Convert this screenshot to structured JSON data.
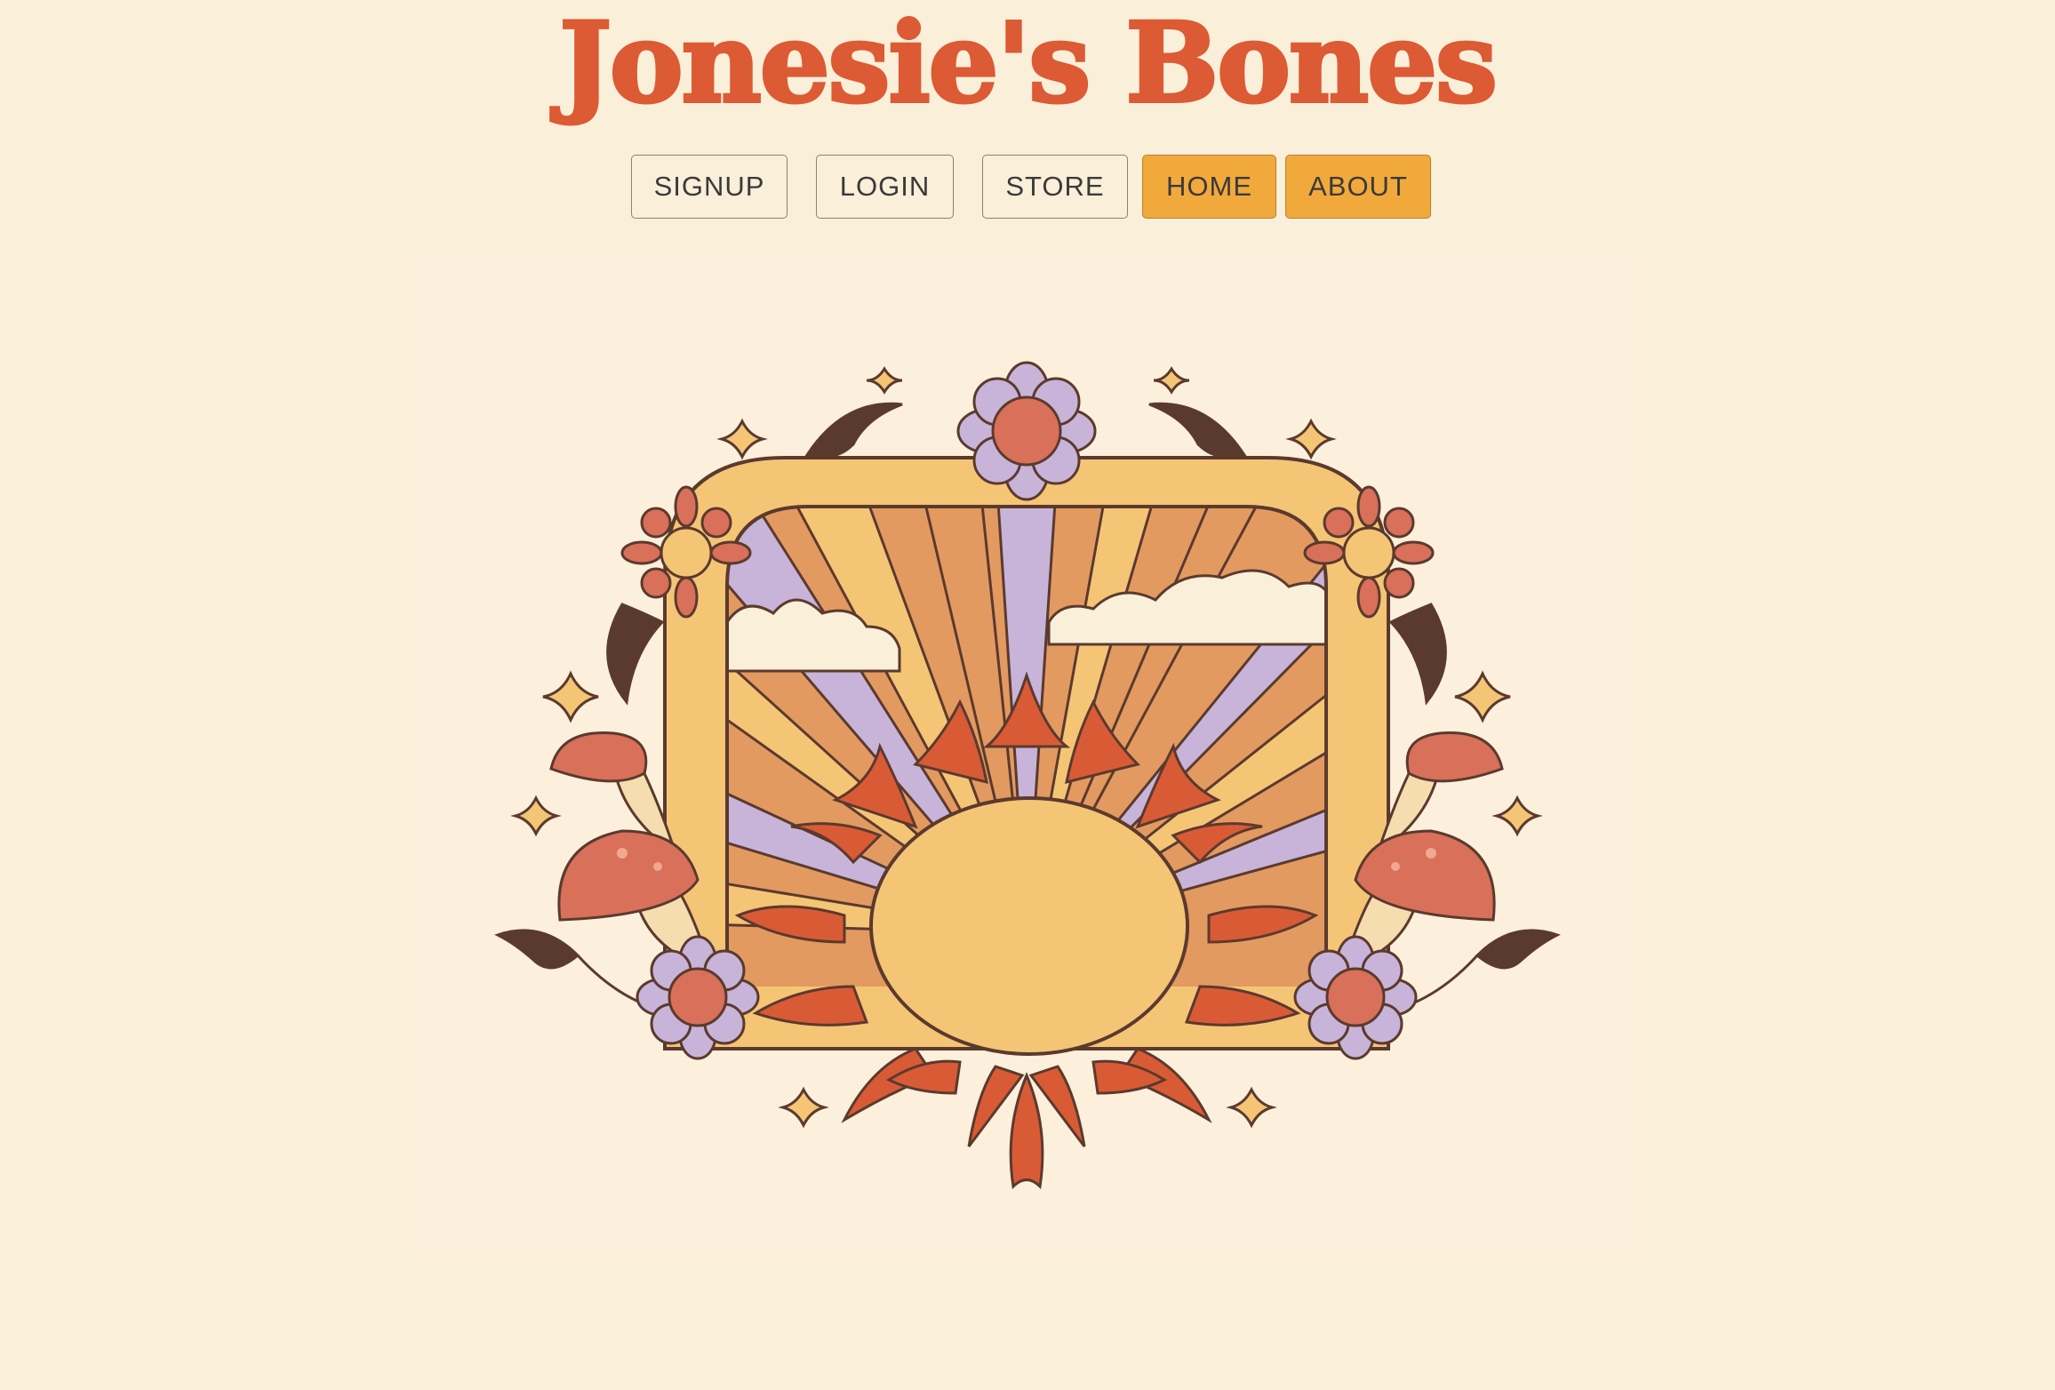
{
  "header": {
    "title": "Jonesie's Bones"
  },
  "nav": {
    "items": [
      {
        "label": "SIGNUP",
        "active": false
      },
      {
        "label": "LOGIN",
        "active": false
      },
      {
        "label": "STORE",
        "active": false
      },
      {
        "label": "HOME",
        "active": true
      },
      {
        "label": "ABOUT",
        "active": true
      }
    ]
  },
  "hero": {
    "image": "retro-sun-arch-illustration"
  },
  "colors": {
    "background": "#FAEFD9",
    "title": "#DC5A34",
    "button_active": "#F2A93B",
    "sun_body": "#F5C576",
    "sun_flames": "#D95B36",
    "outline": "#5B3A2E",
    "lilac": "#C8B4D8",
    "orange_ray": "#E39A60",
    "mushroom": "#D8705A"
  }
}
